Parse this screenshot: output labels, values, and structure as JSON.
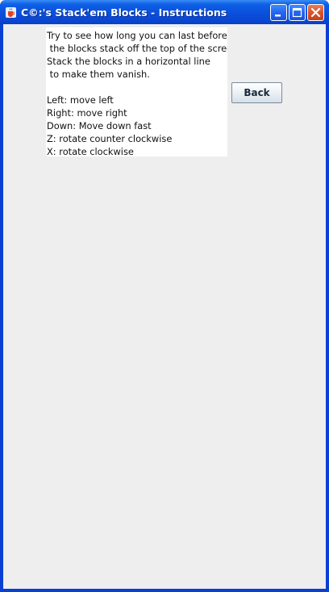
{
  "window": {
    "title": "C©:'s Stack'em Blocks - Instructions"
  },
  "icons": {
    "app": "java-cup-icon",
    "minimize": "minimize-icon",
    "maximize": "maximize-icon",
    "close": "close-icon"
  },
  "instructions": {
    "text": "Try to see how long you can last before\n the blocks stack off the top of the screen.\nStack the blocks in a horizontal line\n to make them vanish.\n\nLeft: move left\nRight: move right\nDown: Move down fast\nZ: rotate counter clockwise\nX: rotate clockwise"
  },
  "buttons": {
    "back_label": "Back"
  },
  "colors": {
    "titlebar": "#0a4fdc",
    "client_background": "#eeeeee",
    "close_button": "#d8532c"
  }
}
